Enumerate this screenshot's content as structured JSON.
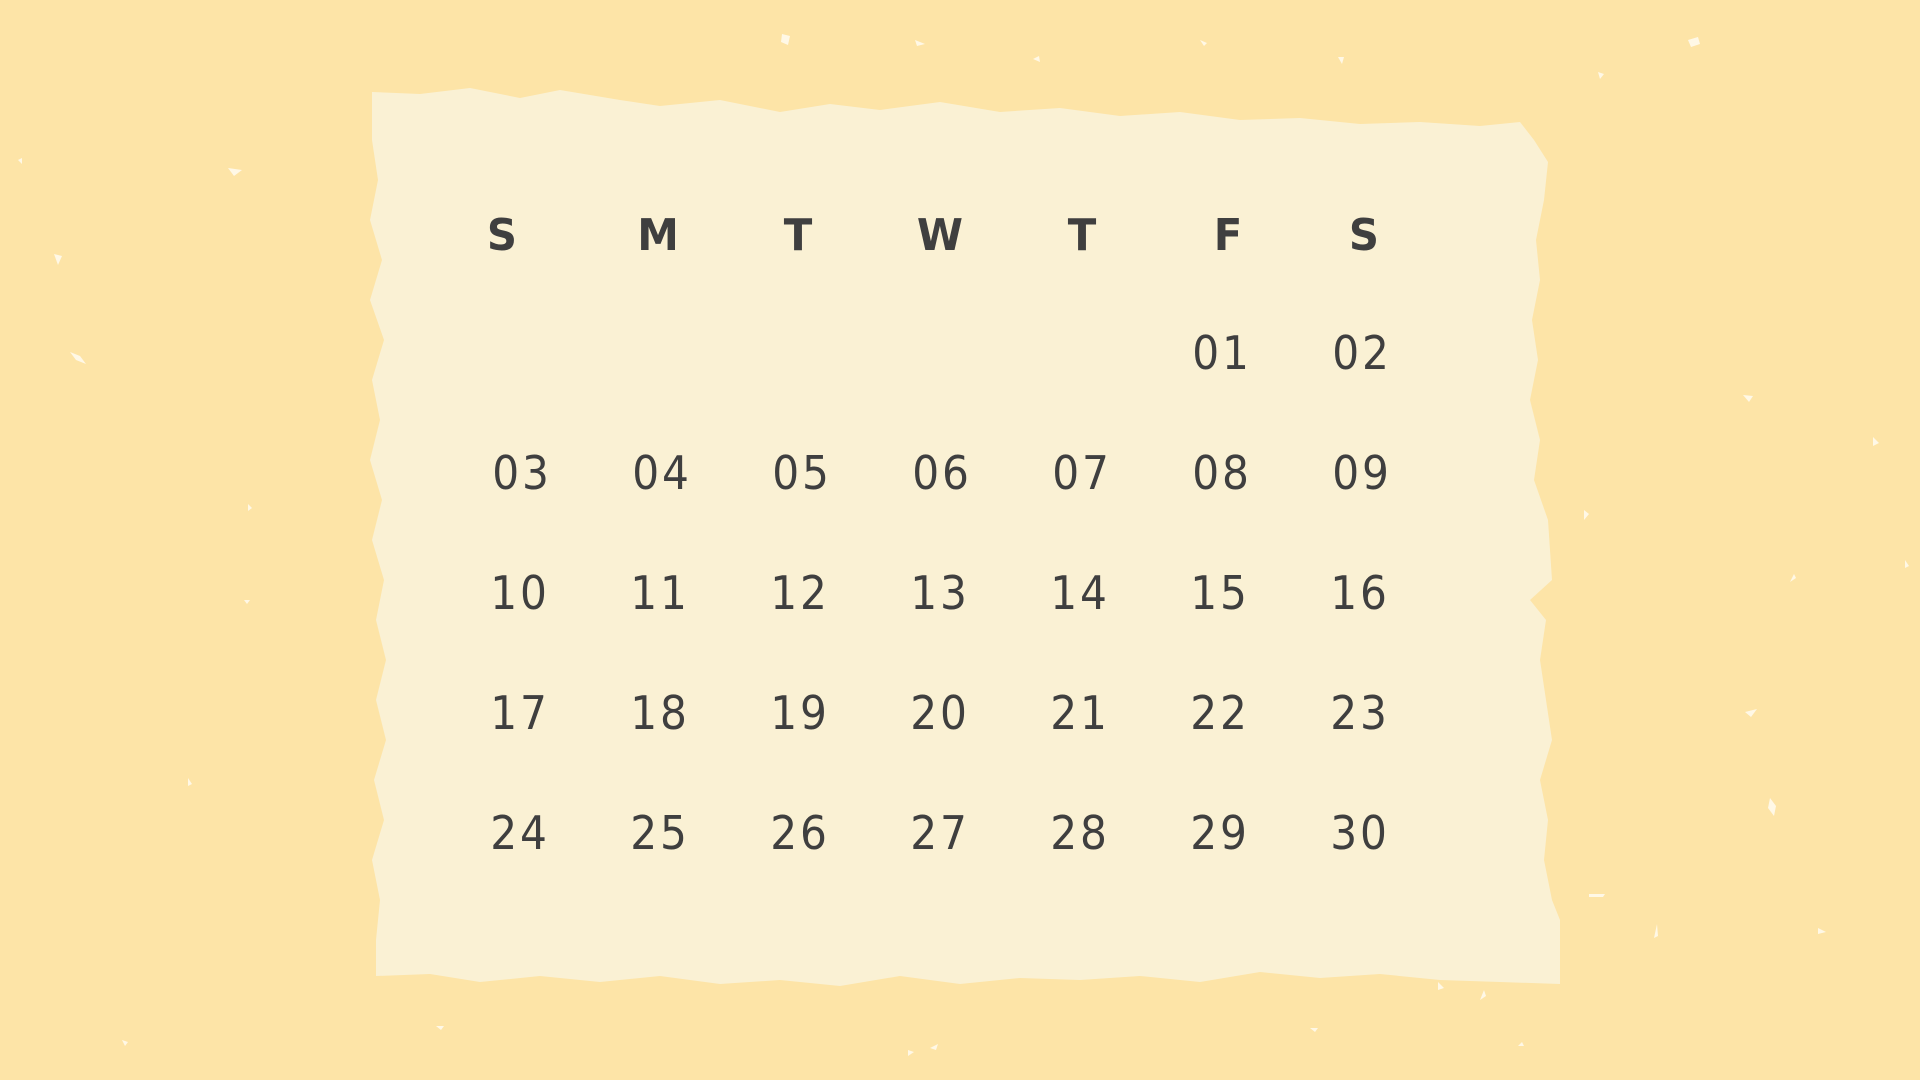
{
  "colors": {
    "background": "#FDE4A7",
    "paper": "#FAF1D4",
    "text": "#3F3F3F",
    "speckle": "#FFF8E6"
  },
  "calendar": {
    "weekdays": [
      "S",
      "M",
      "T",
      "W",
      "T",
      "F",
      "S"
    ],
    "weeks": [
      [
        "",
        "",
        "",
        "",
        "",
        "01",
        "02"
      ],
      [
        "03",
        "04",
        "05",
        "06",
        "07",
        "08",
        "09"
      ],
      [
        "10",
        "11",
        "12",
        "13",
        "14",
        "15",
        "16"
      ],
      [
        "17",
        "18",
        "19",
        "20",
        "21",
        "22",
        "23"
      ],
      [
        "24",
        "25",
        "26",
        "27",
        "28",
        "29",
        "30"
      ]
    ]
  }
}
